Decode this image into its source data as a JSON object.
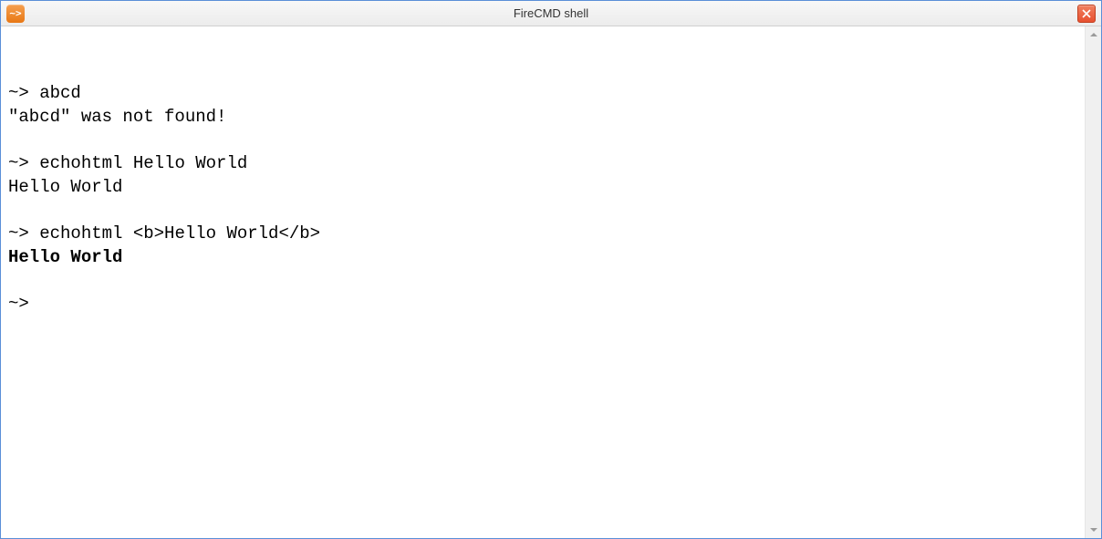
{
  "window": {
    "title": "FireCMD shell",
    "app_icon_text": "~>",
    "close_alt": "Close"
  },
  "terminal": {
    "prompt": "~>",
    "entries": [
      {
        "command": "abcd",
        "output_plain": "\"abcd\" was not found!"
      },
      {
        "command": "echohtml Hello World",
        "output_plain": "Hello World"
      },
      {
        "command": "echohtml <b>Hello World</b>",
        "output_bold": "Hello World"
      }
    ],
    "current_prompt": "~>"
  }
}
